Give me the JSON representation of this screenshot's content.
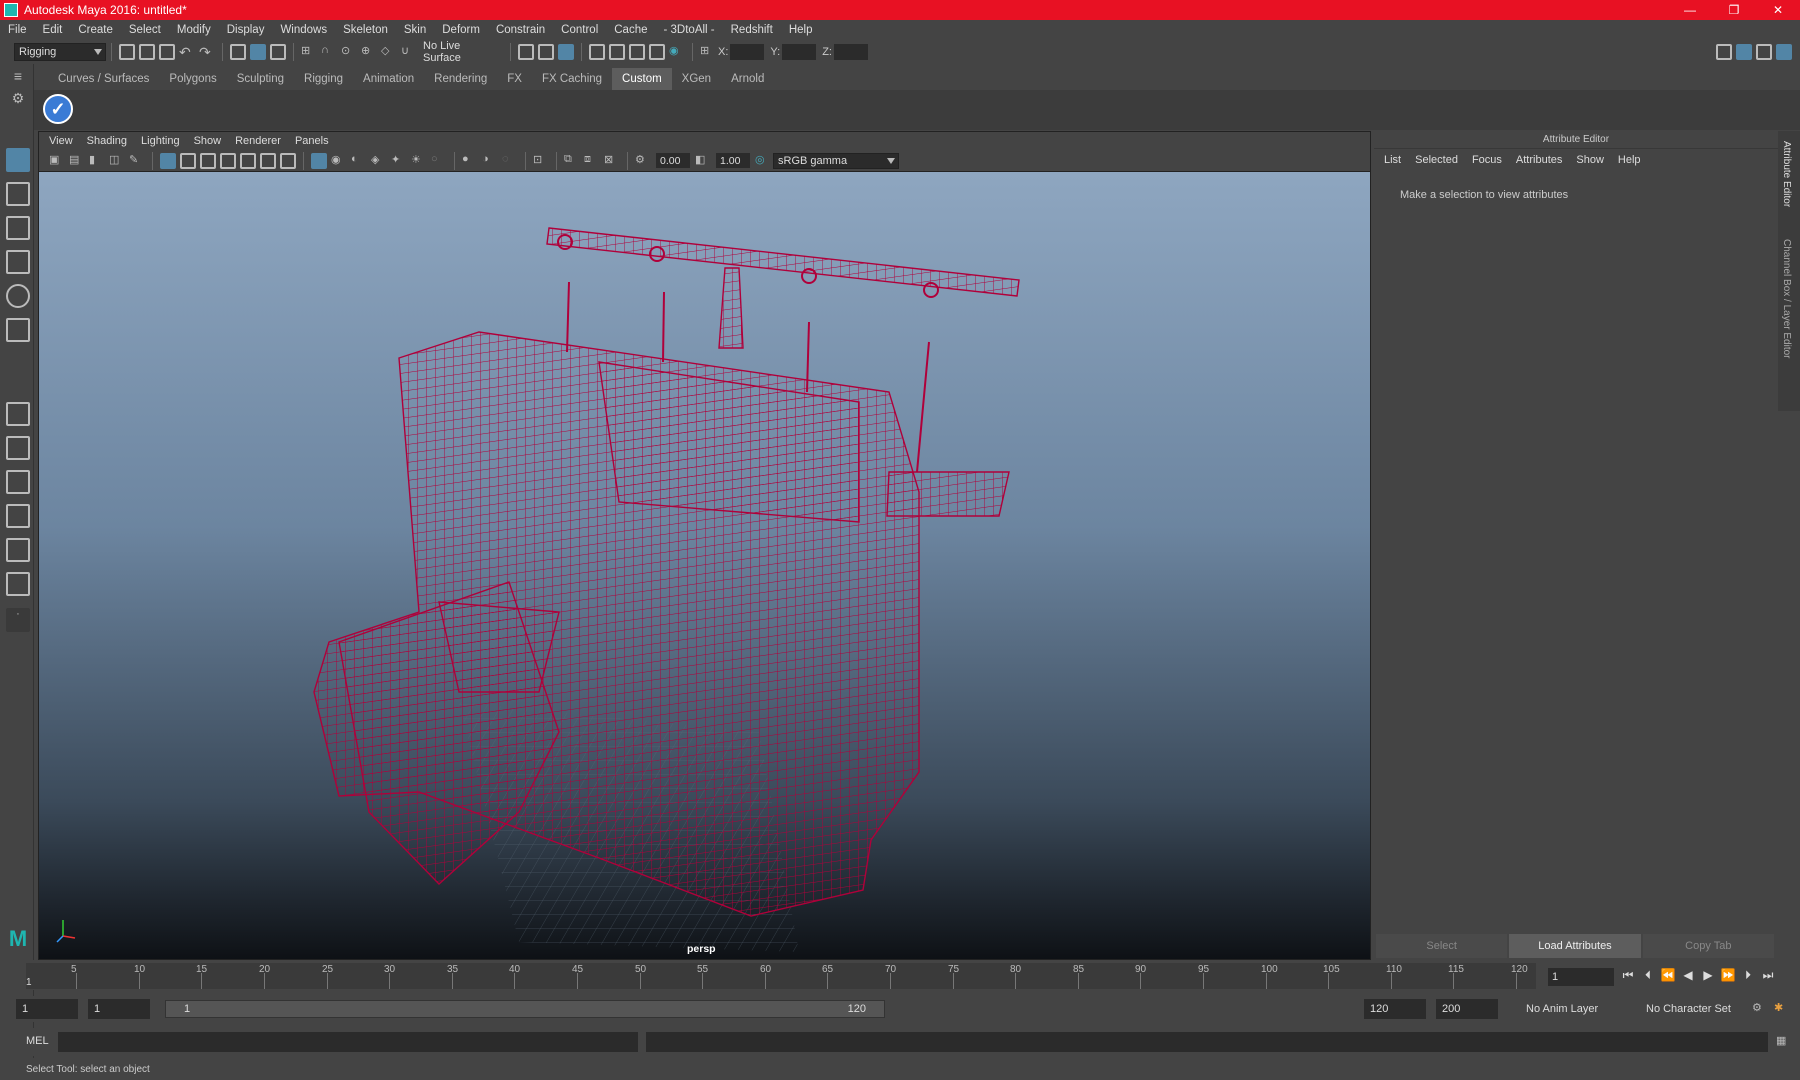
{
  "window": {
    "title": "Autodesk Maya 2016: untitled*",
    "minimize": "—",
    "restore": "❐",
    "close": "✕"
  },
  "menus": [
    "File",
    "Edit",
    "Create",
    "Select",
    "Modify",
    "Display",
    "Windows",
    "Skeleton",
    "Skin",
    "Deform",
    "Constrain",
    "Control",
    "Cache",
    "- 3DtoAll -",
    "Redshift",
    "Help"
  ],
  "statusline": {
    "mode": "Rigging",
    "live_surface": "No Live Surface",
    "x_label": "X:",
    "y_label": "Y:",
    "z_label": "Z:"
  },
  "shelf_tabs": [
    "Curves / Surfaces",
    "Polygons",
    "Sculpting",
    "Rigging",
    "Animation",
    "Rendering",
    "FX",
    "FX Caching",
    "Custom",
    "XGen",
    "Arnold"
  ],
  "shelf_active": "Custom",
  "panel": {
    "menus": [
      "View",
      "Shading",
      "Lighting",
      "Show",
      "Renderer",
      "Panels"
    ],
    "exposure": "0.00",
    "gamma": "1.00",
    "color_space": "sRGB gamma",
    "camera_label": "persp"
  },
  "attribute_editor": {
    "title": "Attribute Editor",
    "menus": [
      "List",
      "Selected",
      "Focus",
      "Attributes",
      "Show",
      "Help"
    ],
    "hint": "Make a selection to view attributes",
    "buttons": {
      "select": "Select",
      "load": "Load Attributes",
      "copy": "Copy Tab"
    }
  },
  "side_tabs": {
    "attr": "Attribute Editor",
    "channel": "Channel Box / Layer Editor"
  },
  "timeline": {
    "ticks": [
      "5",
      "10",
      "15",
      "20",
      "25",
      "30",
      "35",
      "40",
      "45",
      "50",
      "55",
      "60",
      "65",
      "70",
      "75",
      "80",
      "85",
      "90",
      "95",
      "100",
      "105",
      "110",
      "115",
      "120"
    ],
    "start_marker": "1",
    "current_frame": "1"
  },
  "range": {
    "start": "1",
    "playback_start": "1",
    "slider_start": "1",
    "slider_end": "120",
    "playback_end": "120",
    "end": "200",
    "anim_layer": "No Anim Layer",
    "char_set": "No Character Set"
  },
  "command": {
    "lang": "MEL"
  },
  "help_line": "Select Tool: select an object",
  "colors": {
    "titlebar": "#e81123",
    "wireframe": "#b0003a",
    "accent": "#5285a6"
  }
}
